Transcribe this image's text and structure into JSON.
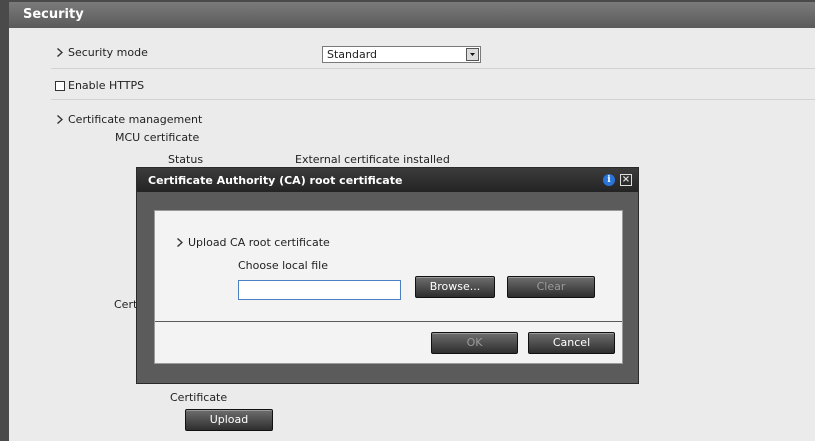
{
  "header": {
    "title": "Security"
  },
  "security_mode": {
    "label": "Security mode",
    "value": "Standard"
  },
  "https": {
    "label": "Enable HTTPS",
    "checked": false
  },
  "cert_management": {
    "label": "Certificate management",
    "mcu_label": "MCU certificate",
    "status_label": "Status",
    "status_value": "External certificate installed",
    "truncated_label": "Cert",
    "certificate_label": "Certificate",
    "upload_label": "Upload"
  },
  "modal": {
    "title": "Certificate Authority (CA) root certificate",
    "info_icon": "i",
    "close_icon": "×",
    "section_label": "Upload CA root certificate",
    "choose_label": "Choose local file",
    "file_value": "",
    "browse_label": "Browse...",
    "clear_label": "Clear",
    "ok_label": "OK",
    "cancel_label": "Cancel"
  },
  "colors": {
    "header_bg": "#6a6a6a",
    "modal_title_bg": "#2f2f2f",
    "info_blue": "#2a73d8",
    "input_border": "#4a7fc1"
  }
}
